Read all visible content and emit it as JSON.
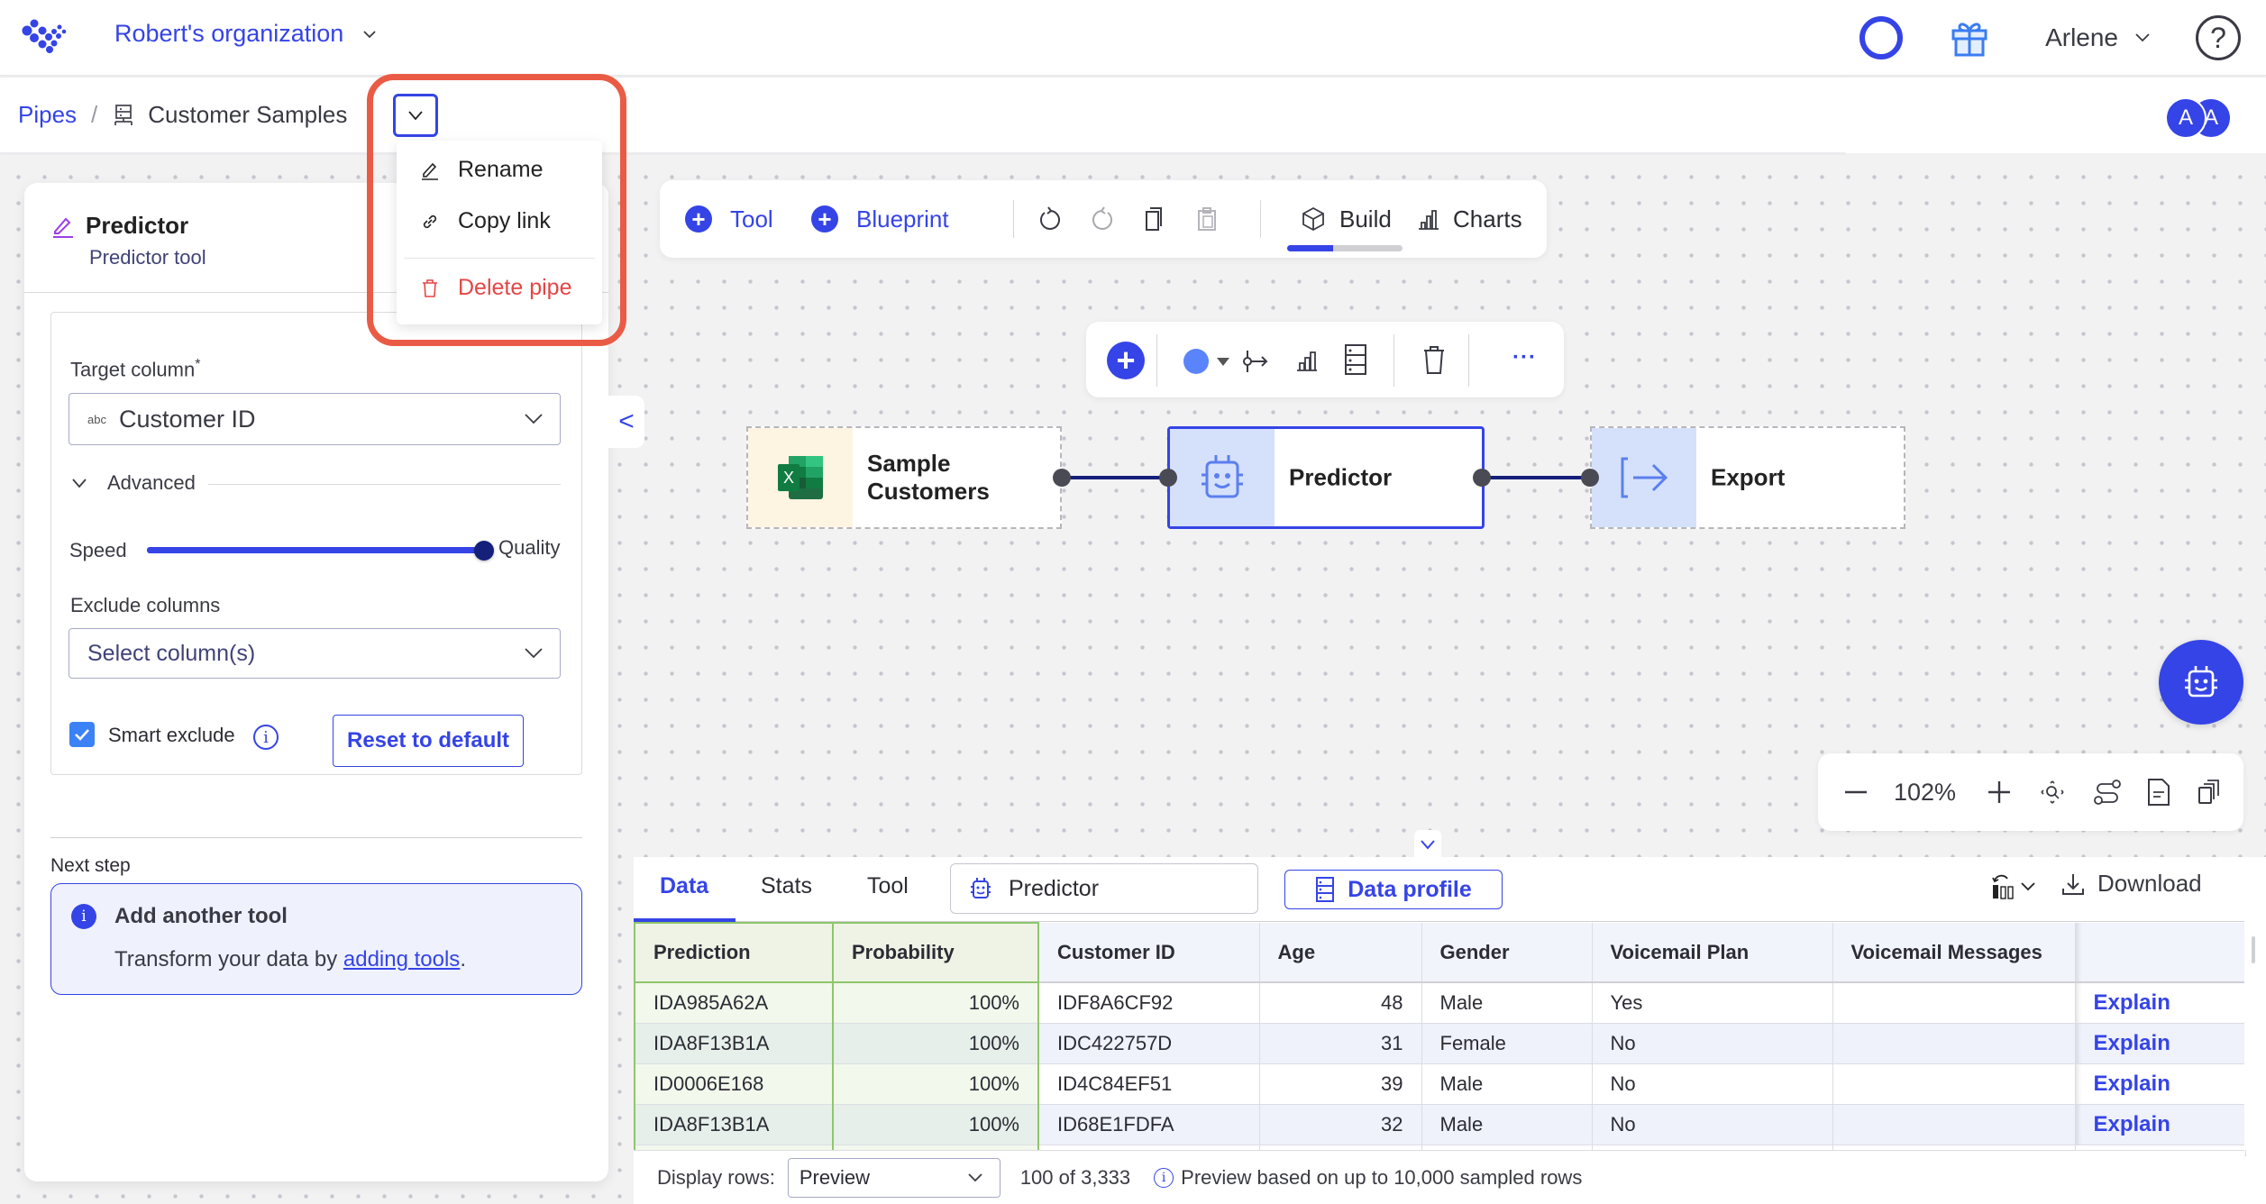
{
  "header": {
    "org_name": "Robert's organization",
    "user_name": "Arlene",
    "help_label": "?"
  },
  "breadcrumb": {
    "root": "Pipes",
    "separator": "/",
    "current": "Customer Samples"
  },
  "pipe_menu": {
    "items": [
      {
        "label": "Rename",
        "icon": "pencil-icon"
      },
      {
        "label": "Copy link",
        "icon": "link-icon"
      },
      {
        "label": "Delete pipe",
        "icon": "trash-icon",
        "danger": true
      }
    ]
  },
  "collaborators": [
    "A",
    "A"
  ],
  "panel": {
    "title": "Predictor",
    "subtitle": "Predictor tool",
    "target_column_label": "Target column",
    "required_mark": "*",
    "target_column_type": "abc",
    "target_column_value": "Customer ID",
    "advanced_label": "Advanced",
    "slider_left": "Speed",
    "slider_right": "Quality",
    "slider_value": 1.0,
    "exclude_label": "Exclude columns",
    "exclude_placeholder": "Select column(s)",
    "smart_exclude_label": "Smart exclude",
    "smart_exclude_checked": true,
    "reset_label": "Reset to default",
    "next_step_label": "Next step",
    "next_title": "Add another tool",
    "next_desc_prefix": "Transform your data by ",
    "next_desc_link": "adding tools",
    "next_desc_suffix": ".",
    "collapse_glyph": "<"
  },
  "toolbar": {
    "tool_label": "Tool",
    "blueprint_label": "Blueprint",
    "build_label": "Build",
    "charts_label": "Charts",
    "mode_progress": 0.4
  },
  "nodes": [
    {
      "label_line1": "Sample",
      "label_line2": "Customers",
      "icon": "excel-icon"
    },
    {
      "label_line1": "Predictor",
      "label_line2": "",
      "icon": "robot-icon",
      "selected": true
    },
    {
      "label_line1": "Export",
      "label_line2": "",
      "icon": "export-icon"
    }
  ],
  "zoom": {
    "level": "102%"
  },
  "data_panel": {
    "tabs": [
      "Data",
      "Stats",
      "Tool"
    ],
    "active_tab": "Data",
    "tool_select": "Predictor",
    "data_profile_label": "Data profile",
    "download_label": "Download",
    "columns": [
      "Prediction",
      "Probability",
      "Customer ID",
      "Age",
      "Gender",
      "Voicemail Plan",
      "Voicemail Messages",
      ""
    ],
    "rows": [
      [
        "IDA985A62A",
        "100%",
        "IDF8A6CF92",
        "48",
        "Male",
        "Yes",
        "",
        "Explain"
      ],
      [
        "IDA8F13B1A",
        "100%",
        "IDC422757D",
        "31",
        "Female",
        "No",
        "",
        "Explain"
      ],
      [
        "ID0006E168",
        "100%",
        "ID4C84EF51",
        "39",
        "Male",
        "No",
        "",
        "Explain"
      ],
      [
        "IDA8F13B1A",
        "100%",
        "ID68E1FDFA",
        "32",
        "Male",
        "No",
        "",
        "Explain"
      ]
    ],
    "display_rows_label": "Display rows:",
    "display_rows_value": "Preview",
    "row_count": "100 of 3,333",
    "preview_note": "Preview based on up to 10,000 sampled rows"
  },
  "colors": {
    "accent": "#3544e6",
    "danger": "#e54545",
    "highlight": "#ea5b45",
    "slider_knob": "#15207a",
    "checkbox": "#3b82f6"
  }
}
